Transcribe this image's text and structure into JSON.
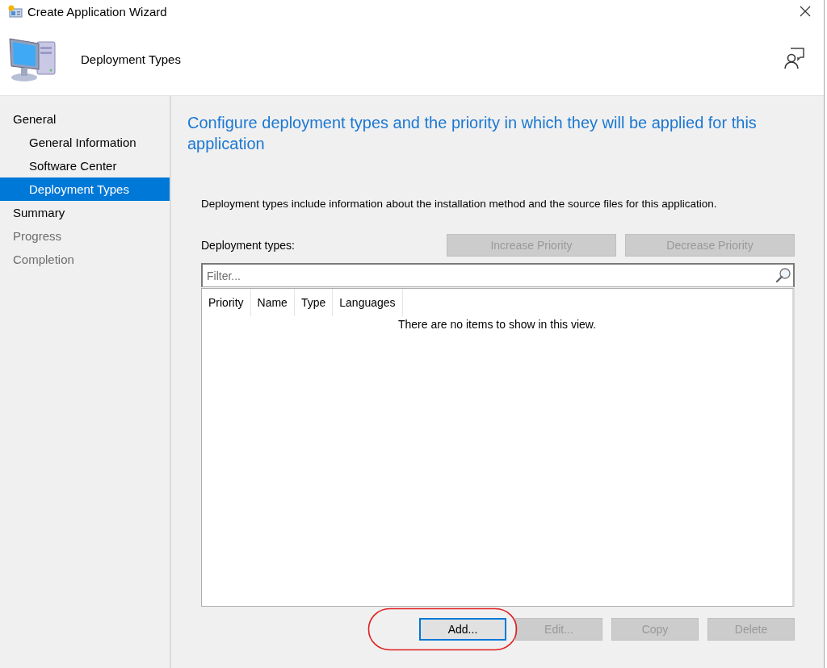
{
  "window": {
    "title": "Create Application Wizard"
  },
  "header": {
    "title": "Deployment Types"
  },
  "sidebar": {
    "items": [
      {
        "label": "General",
        "selected": false,
        "disabled": false,
        "children": [
          {
            "label": "General Information",
            "selected": false,
            "disabled": false
          },
          {
            "label": "Software Center",
            "selected": false,
            "disabled": false
          },
          {
            "label": "Deployment Types",
            "selected": true,
            "disabled": false
          }
        ]
      },
      {
        "label": "Summary",
        "selected": false,
        "disabled": false
      },
      {
        "label": "Progress",
        "selected": false,
        "disabled": true
      },
      {
        "label": "Completion",
        "selected": false,
        "disabled": true
      }
    ]
  },
  "main": {
    "heading": "Configure deployment types and the priority in which they will be applied for this application",
    "description": "Deployment types include information about the installation method and the source files for this application.",
    "list_label": "Deployment types:",
    "priority_buttons": [
      {
        "label": "Increase Priority",
        "disabled": true
      },
      {
        "label": "Decrease Priority",
        "disabled": true
      }
    ],
    "filter": {
      "placeholder": "Filter..."
    },
    "columns": [
      "Priority",
      "Name",
      "Type",
      "Languages"
    ],
    "empty_message": "There are no items to show in this view.",
    "action_buttons": [
      {
        "label": "Add...",
        "disabled": false,
        "focused": true
      },
      {
        "label": "Edit...",
        "disabled": true,
        "focused": false
      },
      {
        "label": "Copy",
        "disabled": true,
        "focused": false
      },
      {
        "label": "Delete",
        "disabled": true,
        "focused": false
      }
    ]
  }
}
